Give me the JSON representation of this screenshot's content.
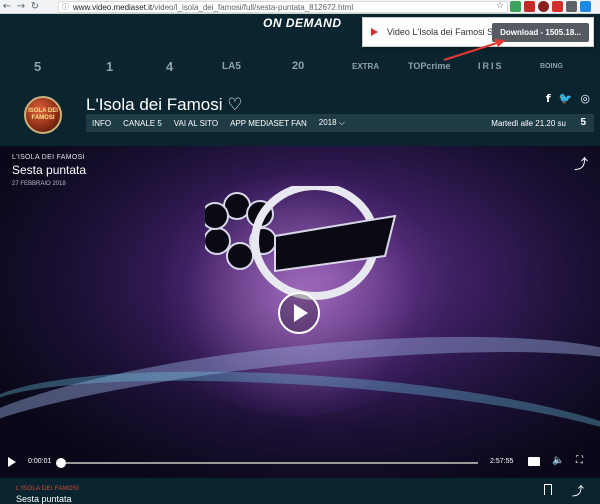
{
  "browser": {
    "back_icon": "←",
    "forward_icon": "→",
    "reload_icon": "↻",
    "lock_icon": "ⓘ",
    "url_prefix": "www.video.mediaset.it",
    "url_rest": "/video/l_isola_dei_famosi/full/sesta-puntata_812672.html",
    "star_icon": "☆"
  },
  "download_popup": {
    "title": "Video L'Isola dei Famosi Sest...",
    "button": "Download - 1505.18..."
  },
  "header": {
    "section": "ON DEMAND",
    "channels": [
      "5",
      "1",
      "4",
      "LA5",
      "20",
      "EXTRA",
      "TOPcrime",
      "IRIS",
      "BOING"
    ]
  },
  "show": {
    "logo_text": "ISOLA DEI FAMOSI",
    "title": "L'Isola dei Famosi ♡",
    "social": [
      "f",
      "🐦",
      "◎"
    ],
    "nav": [
      "INFO",
      "CANALE 5",
      "VAI AL SITO",
      "APP MEDIASET FAN",
      "2018 ⌵"
    ],
    "schedule": "Martedì alle 21.20 su",
    "channel_logo": "5"
  },
  "video": {
    "show_label": "L'ISOLA DEI FAMOSI",
    "title": "Sesta puntata",
    "date": "27 FEBBRAIO 2018",
    "current_time": "0:00:01",
    "total_time": "2:57:55",
    "progress": 0.0,
    "share_icon": "⤴",
    "volume_icon": "🔈",
    "fullscreen_icon": "⛶"
  },
  "below": {
    "show_label": "L'ISOLA DEI FAMOSI",
    "next_title": "Sesta puntata",
    "share_icon": "⤴"
  }
}
